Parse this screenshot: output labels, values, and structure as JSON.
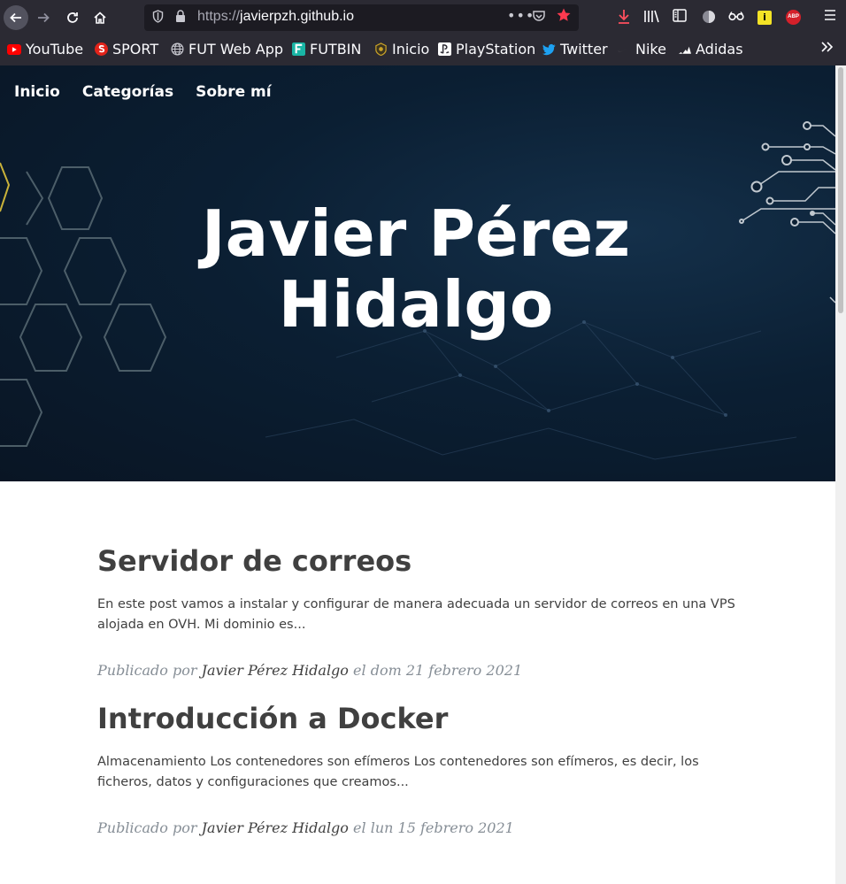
{
  "browser": {
    "url_protocol": "https://",
    "url_host": "javierpzh.github.io",
    "url_more": "•••",
    "icons": {
      "back": "arrow-left-icon",
      "forward": "arrow-right-icon",
      "reload": "reload-icon",
      "home": "home-icon",
      "shield": "tracking-shield-icon",
      "lock": "lock-icon",
      "pocket": "pocket-icon",
      "star": "bookmark-star-icon",
      "download": "download-icon",
      "library": "library-icon",
      "reader": "sidebar-icon",
      "menu": "hamburger-menu-icon"
    },
    "extensions": {
      "ext3_label": "i",
      "abp_label": "ABP"
    },
    "bookmarks": [
      {
        "label": "YouTube",
        "icon": "youtube-icon",
        "color": "#ff0000"
      },
      {
        "label": "SPORT",
        "icon": "sport-icon",
        "color": "#e2231a"
      },
      {
        "label": "FUT Web App",
        "icon": "globe-icon",
        "color": "#c8c8d0"
      },
      {
        "label": "FUTBIN",
        "icon": "futbin-icon",
        "color": "#19b5a5"
      },
      {
        "label": "Inicio",
        "icon": "shield-logo-icon",
        "color": "#c9a227"
      },
      {
        "label": "PlayStation",
        "icon": "playstation-icon",
        "color": "#ffffff"
      },
      {
        "label": "Twitter",
        "icon": "twitter-icon",
        "color": "#1da1f2"
      },
      {
        "label": "Nike",
        "icon": "nike-icon",
        "color": "#666666"
      },
      {
        "label": "Adidas",
        "icon": "adidas-icon",
        "color": "#ffffff"
      }
    ]
  },
  "site": {
    "nav": [
      "Inicio",
      "Categorías",
      "Sobre mí"
    ],
    "title_line1": "Javier Pérez",
    "title_line2": "Hidalgo"
  },
  "posts": [
    {
      "title": "Servidor de correos",
      "excerpt": "En este post vamos a instalar y configurar de manera adecuada un servidor de correos en una VPS alojada en OVH. Mi dominio es...",
      "meta_prefix": "Publicado por",
      "author": "Javier Pérez Hidalgo",
      "date": "el dom 21 febrero 2021"
    },
    {
      "title": "Introducción a Docker",
      "excerpt": "Almacenamiento Los contenedores son efímeros Los contenedores son efímeros, es decir, los ficheros, datos y configuraciones que creamos...",
      "meta_prefix": "Publicado por",
      "author": "Javier Pérez Hidalgo",
      "date": "el lun 15 febrero 2021"
    }
  ]
}
